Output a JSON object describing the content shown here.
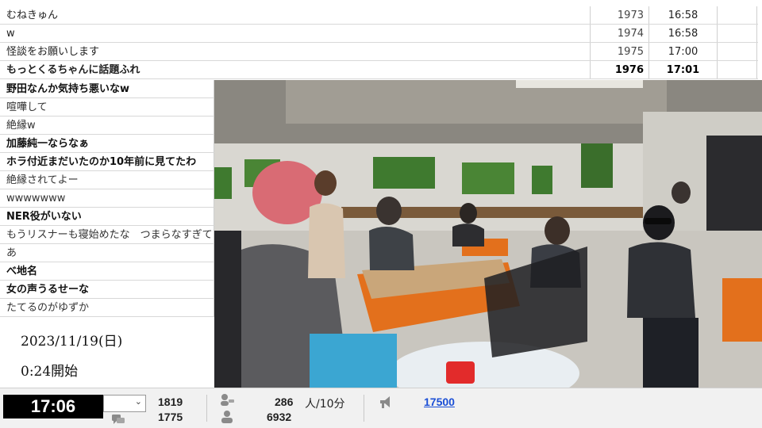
{
  "top_comments": [
    {
      "text": "むねきゅん",
      "no": "1973",
      "time": "16:58",
      "bold": false
    },
    {
      "text": "w",
      "no": "1974",
      "time": "16:58",
      "bold": false
    },
    {
      "text": "怪談をお願いします",
      "no": "1975",
      "time": "17:00",
      "bold": false
    },
    {
      "text": "もっとくるちゃんに話題ふれ",
      "no": "1976",
      "time": "17:01",
      "bold": true
    }
  ],
  "left_comments": [
    {
      "text": "野田なんか気持ち悪いなw",
      "bold": true
    },
    {
      "text": "喧嘩して",
      "bold": false
    },
    {
      "text": "絶縁w",
      "bold": false
    },
    {
      "text": "加藤純一ならなぁ",
      "bold": true
    },
    {
      "text": "ホラ付近まだいたのか10年前に見てたわ",
      "bold": true
    },
    {
      "text": "絶縁されてよー",
      "bold": false
    },
    {
      "text": "wwwwwww",
      "bold": false
    },
    {
      "text": "NER役がいない",
      "bold": true
    },
    {
      "text": "もうリスナーも寝始めたな　つまらなすぎて",
      "bold": false
    },
    {
      "text": "あ",
      "bold": false
    },
    {
      "text": "べ地名",
      "bold": true
    },
    {
      "text": "女の声うるせーな",
      "bold": true
    },
    {
      "text": "たてるのがゆずか",
      "bold": false
    }
  ],
  "overlay": {
    "date": "2023/11/19(日)",
    "start": "0:24開始"
  },
  "status_bar": {
    "clock": "17:06",
    "viewers": "1819",
    "comments": "1775",
    "active": "286",
    "active_unit": "人/10分",
    "premium": "6932",
    "points": "17500"
  },
  "colors": {
    "clock_bg": "#000000",
    "link": "#1b4fd6"
  }
}
